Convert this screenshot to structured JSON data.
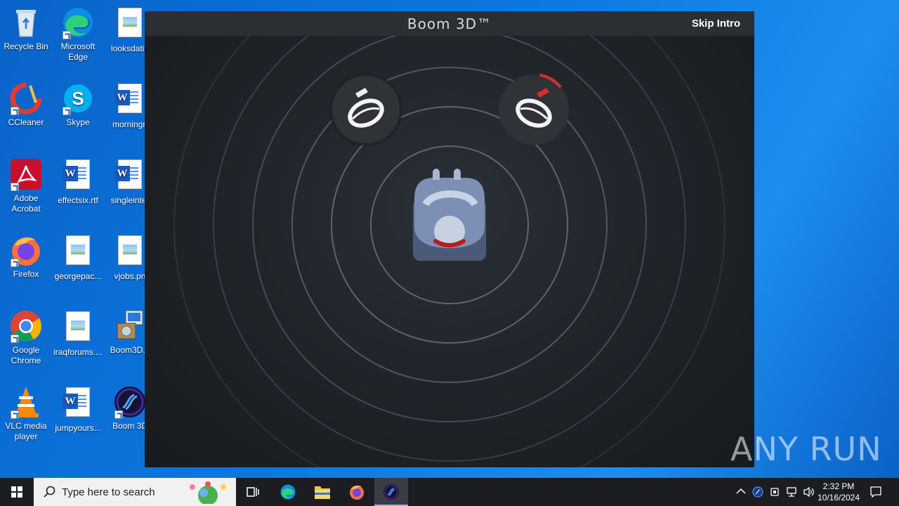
{
  "desktop": {
    "icons": [
      {
        "label": "Recycle Bin"
      },
      {
        "label": "Microsoft Edge"
      },
      {
        "label": "looksdatin"
      },
      {
        "label": "CCleaner"
      },
      {
        "label": "Skype"
      },
      {
        "label": "morningri"
      },
      {
        "label": "Adobe Acrobat"
      },
      {
        "label": "effectsix.rtf"
      },
      {
        "label": "singleinter"
      },
      {
        "label": "Firefox"
      },
      {
        "label": "georgepac..."
      },
      {
        "label": "vjobs.pn"
      },
      {
        "label": "Google Chrome"
      },
      {
        "label": "iraqforums...."
      },
      {
        "label": "Boom3D.n"
      },
      {
        "label": "VLC media player"
      },
      {
        "label": "jumpyours..."
      },
      {
        "label": "Boom 3D"
      }
    ]
  },
  "boom_window": {
    "title": "Boom 3D™",
    "skip_intro_label": "Skip Intro"
  },
  "watermark": {
    "text": "ANY RUN"
  },
  "taskbar": {
    "search_placeholder": "Type here to search",
    "clock_time": "2:32 PM",
    "clock_date": "10/16/2024"
  },
  "colors": {
    "desktop_blue": "#0b78e0",
    "boom_background": "#1e2226",
    "speaker_red_accent": "#d32f2f",
    "taskbar": "#1b1d23"
  }
}
